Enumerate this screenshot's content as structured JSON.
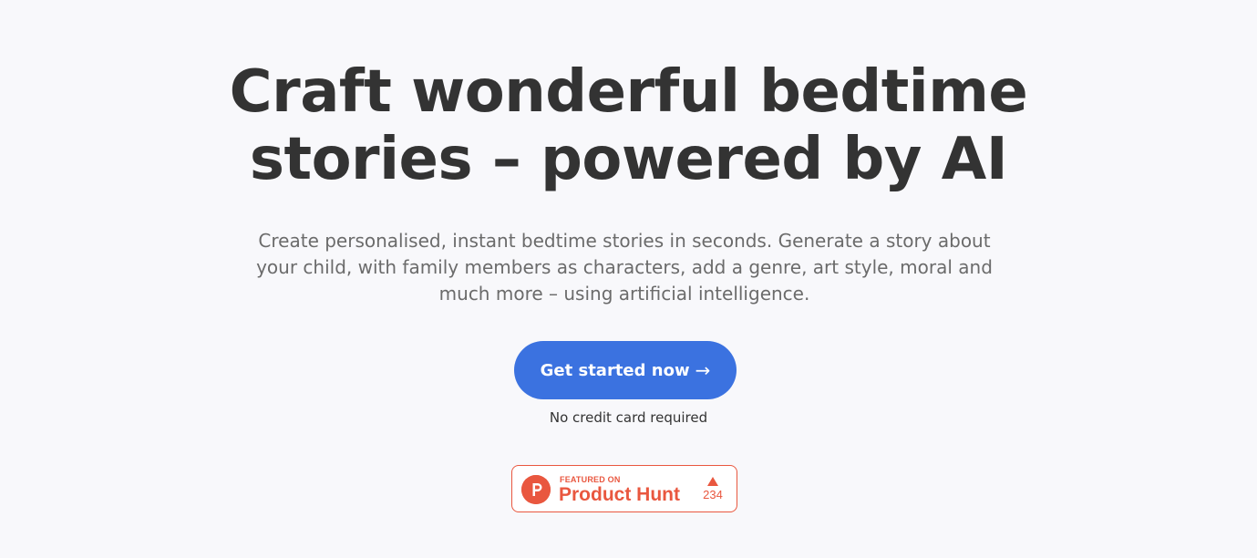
{
  "hero": {
    "headline_line1": "Craft wonderful bedtime",
    "headline_line2": "stories – powered by AI",
    "subtitle_line1": "Create personalised, instant bedtime stories in seconds. Generate a story about",
    "subtitle_line2": "your child, with family members as characters, add a genre, art style, moral and",
    "subtitle_line3": "much more – using artificial intelligence.",
    "cta_label": "Get started now",
    "cta_icon": "arrow-right-icon",
    "note": "No credit card required"
  },
  "product_hunt_badge": {
    "featured_label": "FEATURED ON",
    "name": "Product Hunt",
    "votes": "234",
    "logo_letter": "P",
    "icon": "upvote-triangle-icon",
    "color": "#e9573f"
  },
  "colors": {
    "background": "#f8f8fb",
    "headline": "#333333",
    "subtitle": "#6b6b6b",
    "accent": "#3b72e0"
  }
}
